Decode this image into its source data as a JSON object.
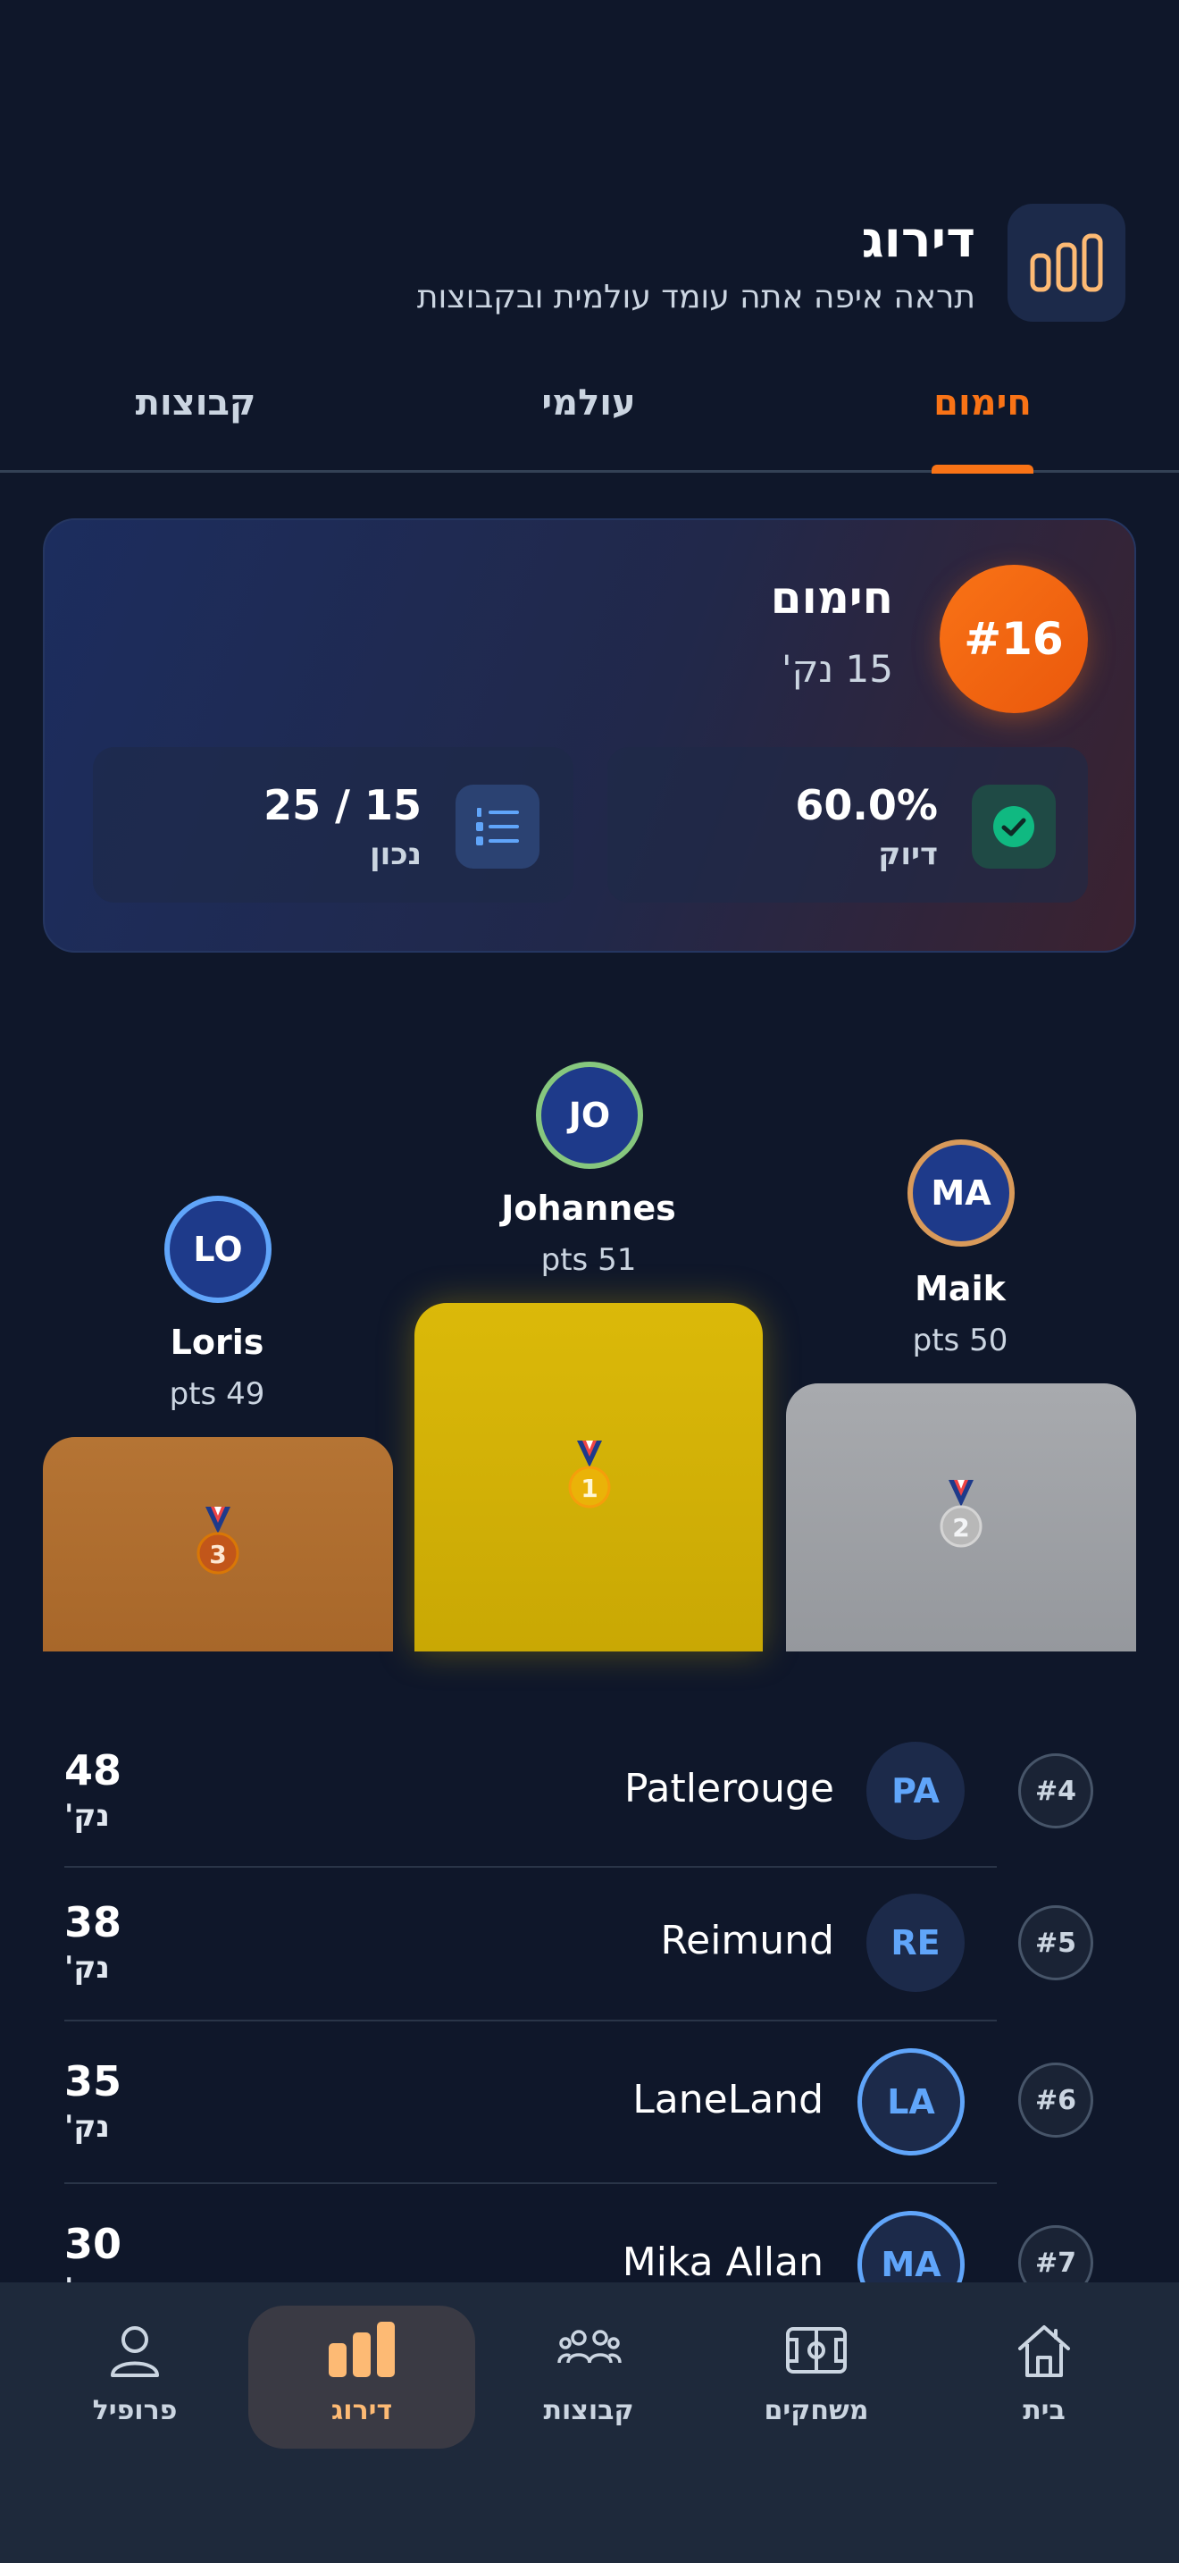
{
  "header": {
    "title": "דירוג",
    "subtitle": "תראה איפה אתה עומד עולמית ובקבוצות",
    "icon": "leaderboard-icon"
  },
  "tabs": [
    {
      "label": "חימום",
      "active": true
    },
    {
      "label": "עולמי",
      "active": false
    },
    {
      "label": "קבוצות",
      "active": false
    }
  ],
  "summary": {
    "rank": "#16",
    "name": "חימום",
    "points": "15 נק'",
    "accuracy": {
      "value": "60.0%",
      "label": "דיוק",
      "icon": "check-circle-icon"
    },
    "correct": {
      "value": "25 / 15",
      "label": "נכון",
      "icon": "numbered-list-icon"
    }
  },
  "podium": [
    {
      "place": 1,
      "initials": "JO",
      "name": "Johannes",
      "points": "pts 51",
      "ring_color": "#86c77e",
      "block_color": "#d4b106",
      "medal": "1"
    },
    {
      "place": 2,
      "initials": "MA",
      "name": "Maik",
      "points": "pts 50",
      "ring_color": "#d99a5a",
      "block_color": "#9ca3af",
      "medal": "2"
    },
    {
      "place": 3,
      "initials": "LO",
      "name": "Loris",
      "points": "pts 49",
      "ring_color": "#60a5fa",
      "block_color": "#b06d2c",
      "medal": "3"
    }
  ],
  "list": [
    {
      "rank": "#4",
      "initials": "PA",
      "name": "Patlerouge",
      "points": "48",
      "unit": "נק'"
    },
    {
      "rank": "#5",
      "initials": "RE",
      "name": "Reimund",
      "points": "38",
      "unit": "נק'"
    },
    {
      "rank": "#6",
      "initials": "LA",
      "name": "LaneLand",
      "points": "35",
      "unit": "נק'"
    },
    {
      "rank": "#7",
      "initials": "MA",
      "name": "Mika Allan",
      "points": "30",
      "unit": "נק'"
    }
  ],
  "nav": [
    {
      "label": "בית",
      "icon": "home-icon"
    },
    {
      "label": "משחקים",
      "icon": "field-icon"
    },
    {
      "label": "קבוצות",
      "icon": "groups-icon"
    },
    {
      "label": "דירוג",
      "icon": "leaderboard-icon",
      "active": true
    },
    {
      "label": "פרופיל",
      "icon": "profile-icon"
    }
  ],
  "colors": {
    "background": "#0f172a",
    "accent": "#f97316",
    "nav_active": "#fdba74",
    "avatar_text": "#60a5fa"
  }
}
